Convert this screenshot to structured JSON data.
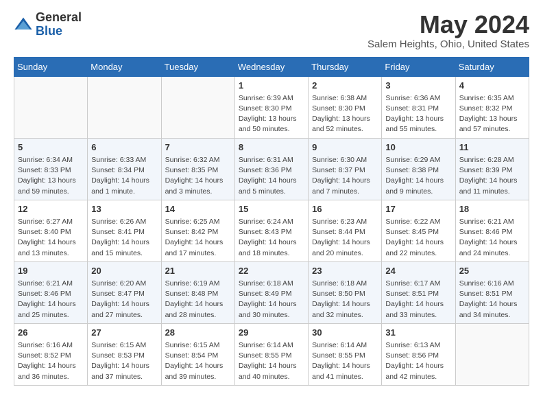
{
  "header": {
    "logo_general": "General",
    "logo_blue": "Blue",
    "month_title": "May 2024",
    "location": "Salem Heights, Ohio, United States"
  },
  "days_of_week": [
    "Sunday",
    "Monday",
    "Tuesday",
    "Wednesday",
    "Thursday",
    "Friday",
    "Saturday"
  ],
  "weeks": [
    [
      {
        "day": "",
        "info": ""
      },
      {
        "day": "",
        "info": ""
      },
      {
        "day": "",
        "info": ""
      },
      {
        "day": "1",
        "info": "Sunrise: 6:39 AM\nSunset: 8:30 PM\nDaylight: 13 hours\nand 50 minutes."
      },
      {
        "day": "2",
        "info": "Sunrise: 6:38 AM\nSunset: 8:30 PM\nDaylight: 13 hours\nand 52 minutes."
      },
      {
        "day": "3",
        "info": "Sunrise: 6:36 AM\nSunset: 8:31 PM\nDaylight: 13 hours\nand 55 minutes."
      },
      {
        "day": "4",
        "info": "Sunrise: 6:35 AM\nSunset: 8:32 PM\nDaylight: 13 hours\nand 57 minutes."
      }
    ],
    [
      {
        "day": "5",
        "info": "Sunrise: 6:34 AM\nSunset: 8:33 PM\nDaylight: 13 hours\nand 59 minutes."
      },
      {
        "day": "6",
        "info": "Sunrise: 6:33 AM\nSunset: 8:34 PM\nDaylight: 14 hours\nand 1 minute."
      },
      {
        "day": "7",
        "info": "Sunrise: 6:32 AM\nSunset: 8:35 PM\nDaylight: 14 hours\nand 3 minutes."
      },
      {
        "day": "8",
        "info": "Sunrise: 6:31 AM\nSunset: 8:36 PM\nDaylight: 14 hours\nand 5 minutes."
      },
      {
        "day": "9",
        "info": "Sunrise: 6:30 AM\nSunset: 8:37 PM\nDaylight: 14 hours\nand 7 minutes."
      },
      {
        "day": "10",
        "info": "Sunrise: 6:29 AM\nSunset: 8:38 PM\nDaylight: 14 hours\nand 9 minutes."
      },
      {
        "day": "11",
        "info": "Sunrise: 6:28 AM\nSunset: 8:39 PM\nDaylight: 14 hours\nand 11 minutes."
      }
    ],
    [
      {
        "day": "12",
        "info": "Sunrise: 6:27 AM\nSunset: 8:40 PM\nDaylight: 14 hours\nand 13 minutes."
      },
      {
        "day": "13",
        "info": "Sunrise: 6:26 AM\nSunset: 8:41 PM\nDaylight: 14 hours\nand 15 minutes."
      },
      {
        "day": "14",
        "info": "Sunrise: 6:25 AM\nSunset: 8:42 PM\nDaylight: 14 hours\nand 17 minutes."
      },
      {
        "day": "15",
        "info": "Sunrise: 6:24 AM\nSunset: 8:43 PM\nDaylight: 14 hours\nand 18 minutes."
      },
      {
        "day": "16",
        "info": "Sunrise: 6:23 AM\nSunset: 8:44 PM\nDaylight: 14 hours\nand 20 minutes."
      },
      {
        "day": "17",
        "info": "Sunrise: 6:22 AM\nSunset: 8:45 PM\nDaylight: 14 hours\nand 22 minutes."
      },
      {
        "day": "18",
        "info": "Sunrise: 6:21 AM\nSunset: 8:46 PM\nDaylight: 14 hours\nand 24 minutes."
      }
    ],
    [
      {
        "day": "19",
        "info": "Sunrise: 6:21 AM\nSunset: 8:46 PM\nDaylight: 14 hours\nand 25 minutes."
      },
      {
        "day": "20",
        "info": "Sunrise: 6:20 AM\nSunset: 8:47 PM\nDaylight: 14 hours\nand 27 minutes."
      },
      {
        "day": "21",
        "info": "Sunrise: 6:19 AM\nSunset: 8:48 PM\nDaylight: 14 hours\nand 28 minutes."
      },
      {
        "day": "22",
        "info": "Sunrise: 6:18 AM\nSunset: 8:49 PM\nDaylight: 14 hours\nand 30 minutes."
      },
      {
        "day": "23",
        "info": "Sunrise: 6:18 AM\nSunset: 8:50 PM\nDaylight: 14 hours\nand 32 minutes."
      },
      {
        "day": "24",
        "info": "Sunrise: 6:17 AM\nSunset: 8:51 PM\nDaylight: 14 hours\nand 33 minutes."
      },
      {
        "day": "25",
        "info": "Sunrise: 6:16 AM\nSunset: 8:51 PM\nDaylight: 14 hours\nand 34 minutes."
      }
    ],
    [
      {
        "day": "26",
        "info": "Sunrise: 6:16 AM\nSunset: 8:52 PM\nDaylight: 14 hours\nand 36 minutes."
      },
      {
        "day": "27",
        "info": "Sunrise: 6:15 AM\nSunset: 8:53 PM\nDaylight: 14 hours\nand 37 minutes."
      },
      {
        "day": "28",
        "info": "Sunrise: 6:15 AM\nSunset: 8:54 PM\nDaylight: 14 hours\nand 39 minutes."
      },
      {
        "day": "29",
        "info": "Sunrise: 6:14 AM\nSunset: 8:55 PM\nDaylight: 14 hours\nand 40 minutes."
      },
      {
        "day": "30",
        "info": "Sunrise: 6:14 AM\nSunset: 8:55 PM\nDaylight: 14 hours\nand 41 minutes."
      },
      {
        "day": "31",
        "info": "Sunrise: 6:13 AM\nSunset: 8:56 PM\nDaylight: 14 hours\nand 42 minutes."
      },
      {
        "day": "",
        "info": ""
      }
    ]
  ]
}
